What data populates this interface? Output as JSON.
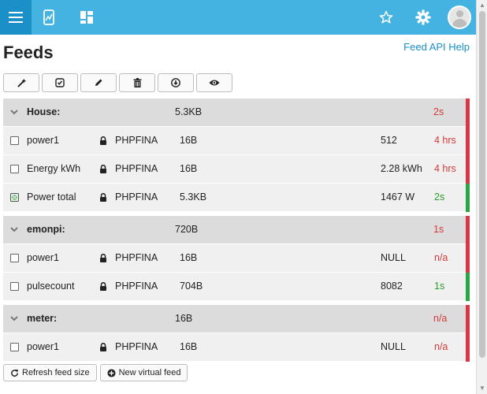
{
  "title": "Feeds",
  "api_help": "Feed API Help",
  "buttons": {
    "refresh": "Refresh feed size",
    "new_virtual": "New virtual feed"
  },
  "colors": {
    "topbar": "#44b3e2",
    "active_tab": "#1a8fc8",
    "status_red": "#dc3545",
    "status_green": "#28a745"
  },
  "groups": [
    {
      "name": "House:",
      "size": "5.3KB",
      "time": "2s",
      "status": "red",
      "feeds": [
        {
          "name": "power1",
          "engine": "PHPFINA",
          "size": "16B",
          "value": "512",
          "time": "4 hrs",
          "status": "red",
          "checked": false
        },
        {
          "name": "Energy kWh",
          "engine": "PHPFINA",
          "size": "16B",
          "value": "2.28 kWh",
          "time": "4 hrs",
          "status": "red",
          "checked": false
        },
        {
          "name": "Power total",
          "engine": "PHPFINA",
          "size": "5.3KB",
          "value": "1467 W",
          "time": "2s",
          "status": "green",
          "checked": true
        }
      ]
    },
    {
      "name": "emonpi:",
      "size": "720B",
      "time": "1s",
      "status": "red",
      "feeds": [
        {
          "name": "power1",
          "engine": "PHPFINA",
          "size": "16B",
          "value": "NULL",
          "time": "n/a",
          "status": "red",
          "checked": false
        },
        {
          "name": "pulsecount",
          "engine": "PHPFINA",
          "size": "704B",
          "value": "8082",
          "time": "1s",
          "status": "green",
          "checked": false
        }
      ]
    },
    {
      "name": "meter:",
      "size": "16B",
      "time": "n/a",
      "status": "red",
      "feeds": [
        {
          "name": "power1",
          "engine": "PHPFINA",
          "size": "16B",
          "value": "NULL",
          "time": "n/a",
          "status": "red",
          "checked": false
        }
      ]
    }
  ]
}
